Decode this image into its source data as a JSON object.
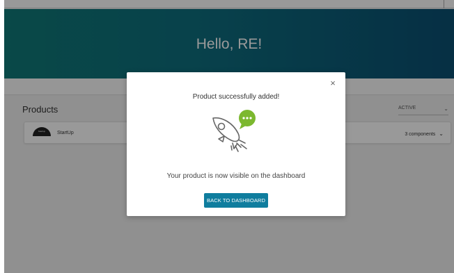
{
  "hero": {
    "greeting": "Hello, RE!"
  },
  "products_section": {
    "title": "Products",
    "status_filter": {
      "selected": "ACTIVE",
      "icon": "chevron-down-icon"
    },
    "items": [
      {
        "logo_text": "StartUp",
        "name": "StartUp",
        "components_label": "3 components",
        "icon": "chevron-down-icon"
      }
    ]
  },
  "modal": {
    "title": "Product successfully added!",
    "message": "Your product is now visible on the dashboard",
    "button_label": "BACK TO DASHBOARD",
    "close_symbol": "×",
    "illustration": "rocket-chat-bubble-icon",
    "colors": {
      "button": "#0f7d9e",
      "bubble": "#7cb82f",
      "rocket_stroke": "#666666"
    }
  },
  "colors": {
    "hero_start": "#0f7a78",
    "hero_end": "#0a4f72",
    "overlay": "rgba(0,0,0,0.40)"
  }
}
